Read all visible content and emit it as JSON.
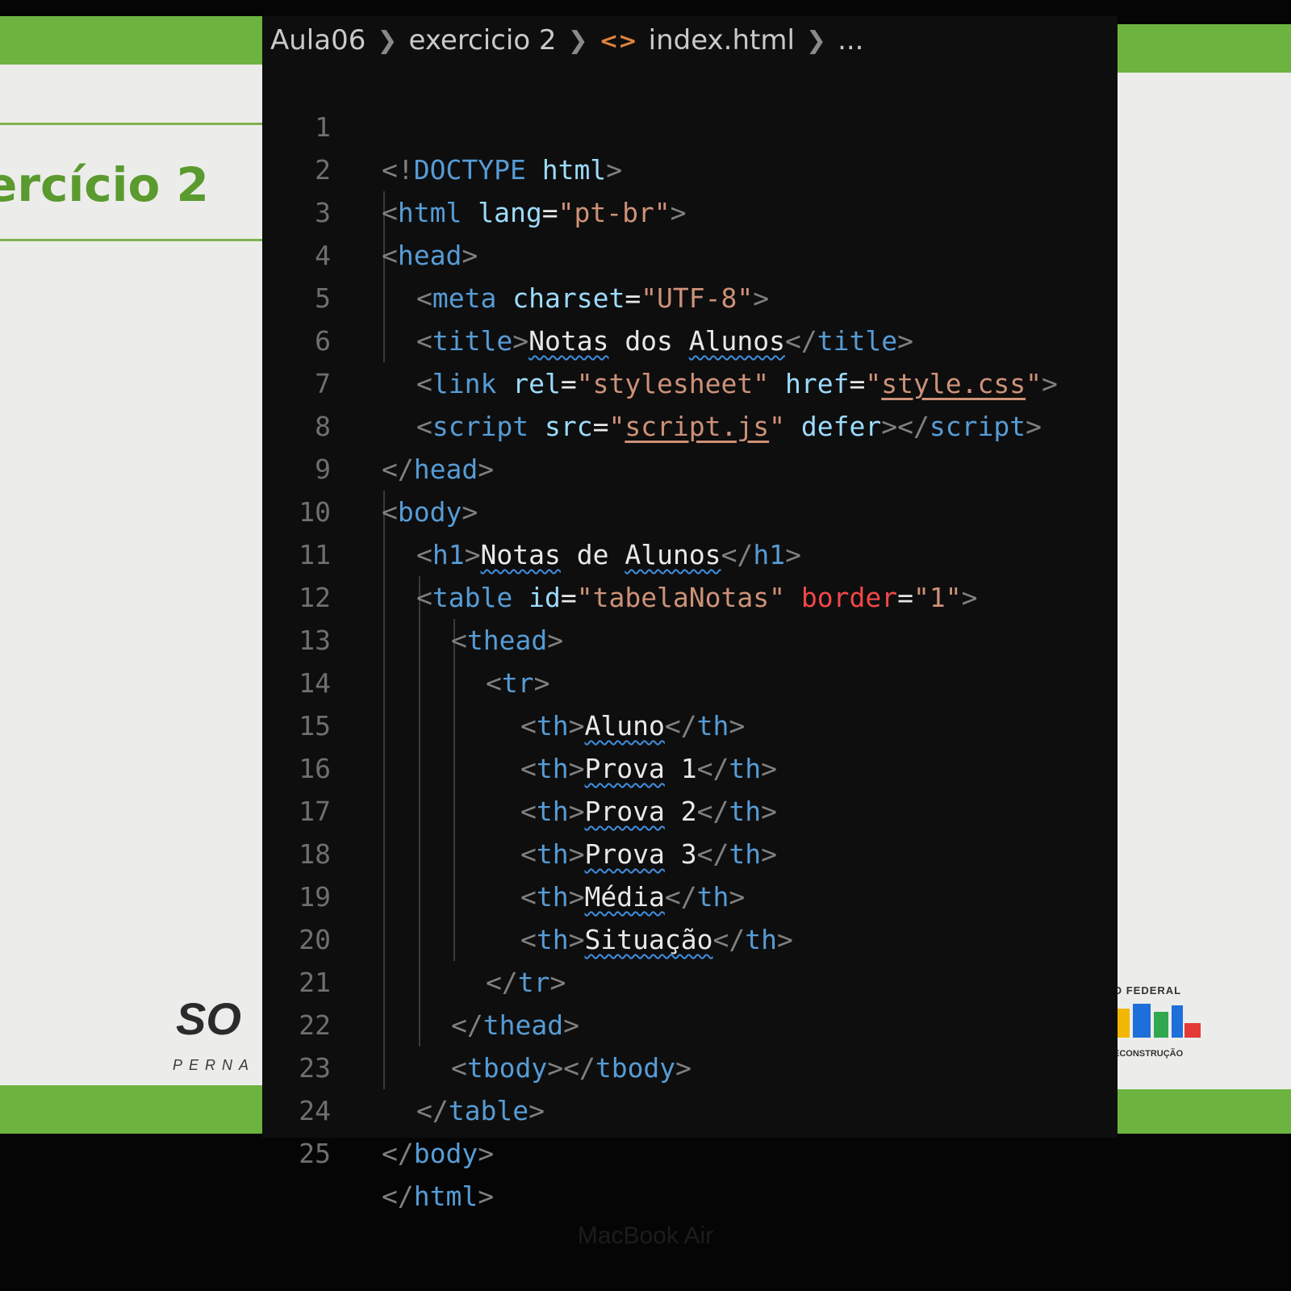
{
  "breadcrumb": {
    "folder": "Aula06",
    "subfolder": "exercicio 2",
    "file": "index.html",
    "more": "..."
  },
  "slide": {
    "title": "ercício 2",
    "logo": "SO",
    "logo_sub": "PERNA",
    "gov_top": "O FEDERAL",
    "gov_bottom": "ECONSTRUÇÃO"
  },
  "code": {
    "line_numbers": [
      "1",
      "2",
      "3",
      "4",
      "5",
      "6",
      "7",
      "8",
      "9",
      "10",
      "11",
      "12",
      "13",
      "14",
      "15",
      "16",
      "17",
      "18",
      "19",
      "20",
      "21",
      "22",
      "23",
      "24",
      "25"
    ],
    "doctype": "DOCTYPE",
    "tag_html": "html",
    "attr_lang": "lang",
    "val_lang": "\"pt-br\"",
    "tag_head": "head",
    "tag_meta": "meta",
    "attr_charset": "charset",
    "val_charset": "\"UTF-8\"",
    "tag_title": "title",
    "title_word1": "Notas",
    "title_word2": "dos",
    "title_word3": "Alunos",
    "tag_link": "link",
    "attr_rel": "rel",
    "val_rel": "\"stylesheet\"",
    "attr_href": "href",
    "val_href": "style.css",
    "tag_script": "script",
    "attr_src": "src",
    "val_src": "script.js",
    "attr_defer": "defer",
    "tag_body": "body",
    "tag_h1": "h1",
    "h1_word1": "Notas",
    "h1_word2": "de",
    "h1_word3": "Alunos",
    "tag_table": "table",
    "attr_id": "id",
    "val_id": "\"tabelaNotas\"",
    "attr_border": "border",
    "val_border": "\"1\"",
    "tag_thead": "thead",
    "tag_tr": "tr",
    "tag_th": "th",
    "th_aluno": "Aluno",
    "th_prova": "Prova",
    "th_num1": "1",
    "th_num2": "2",
    "th_num3": "3",
    "th_media": "Média",
    "th_situacao": "Situação",
    "tag_tbody": "tbody"
  },
  "device_label": "MacBook Air"
}
